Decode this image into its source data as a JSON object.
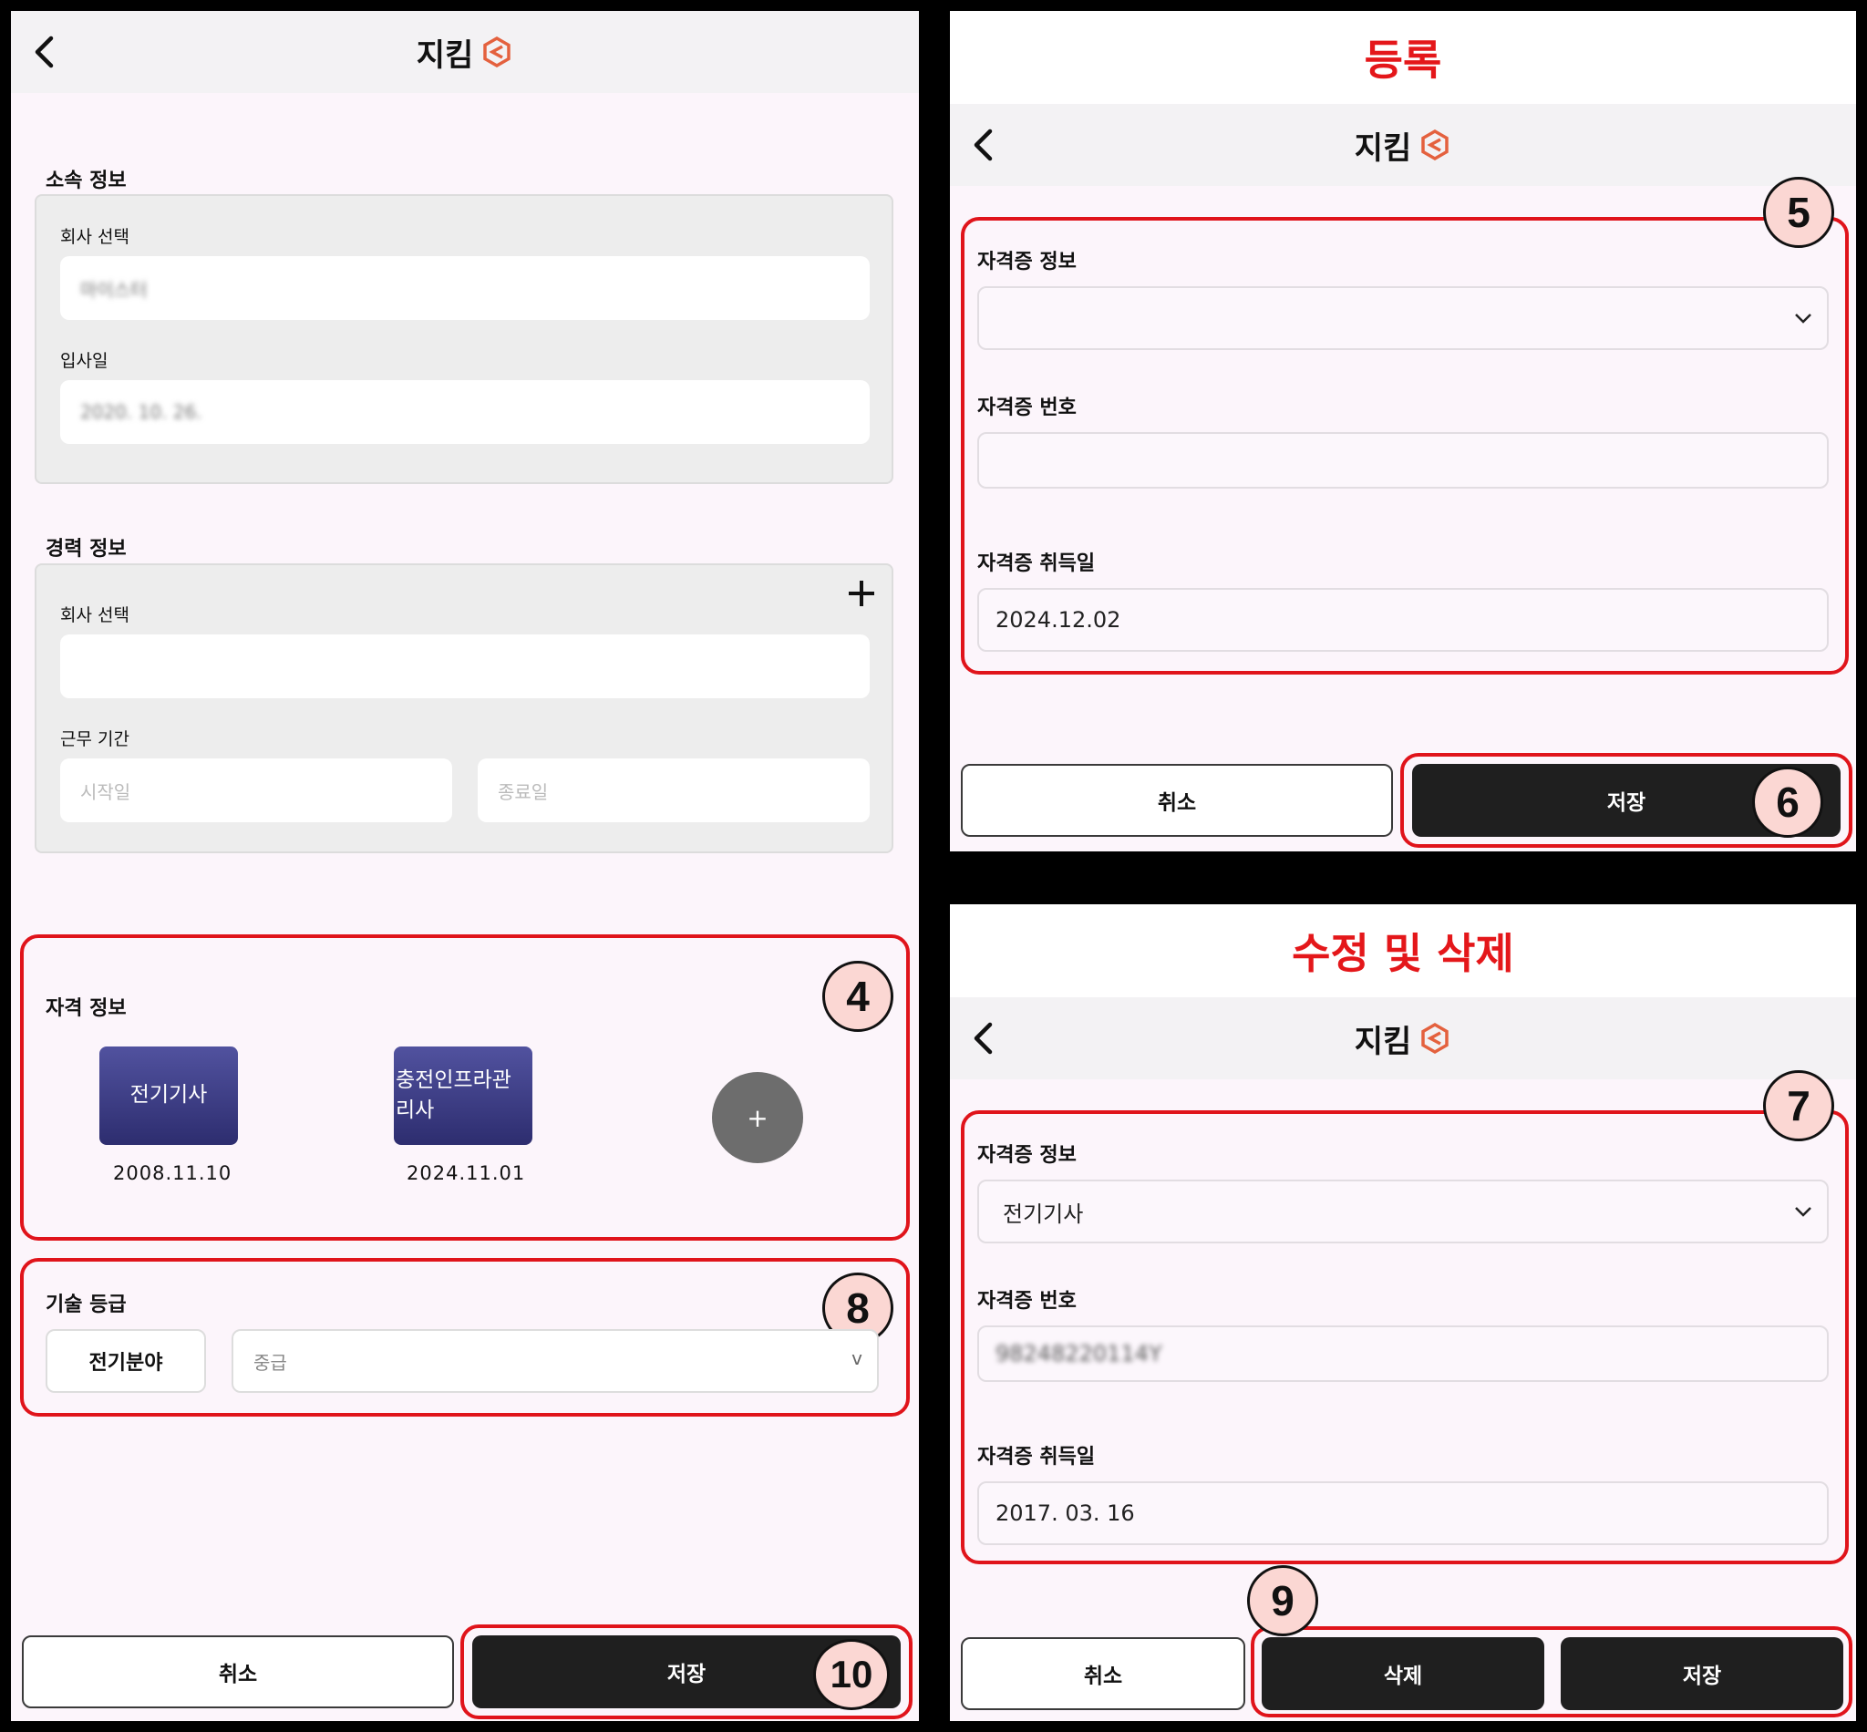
{
  "app": {
    "title": "지킴"
  },
  "left": {
    "affiliation": {
      "title": "소속 정보",
      "company_label": "회사 선택",
      "company_value": "마이스터",
      "hire_label": "입사일",
      "hire_value": "2020. 10. 26."
    },
    "career": {
      "title": "경력 정보",
      "company_label": "회사 선택",
      "period_label": "근무 기간",
      "start_placeholder": "시작일",
      "end_placeholder": "종료일"
    },
    "qualification": {
      "title": "자격 정보",
      "certs": [
        {
          "name": "전기기사",
          "date": "2008.11.10"
        },
        {
          "name": "충전인프라관리사",
          "date": "2024.11.01"
        }
      ],
      "add_label": "+"
    },
    "skill": {
      "title": "기술 등급",
      "field_label": "전기분야",
      "grade_value": "중급",
      "grade_arrow": "v"
    },
    "buttons": {
      "cancel": "취소",
      "save": "저장"
    }
  },
  "register": {
    "banner": "등록",
    "cert_info_label": "자격증 정보",
    "cert_number_label": "자격증 번호",
    "cert_date_label": "자격증 취득일",
    "cert_date_value": "2024.12.02",
    "buttons": {
      "cancel": "취소",
      "save": "저장"
    }
  },
  "edit": {
    "banner": "수정 및 삭제",
    "cert_info_label": "자격증 정보",
    "cert_info_value": "전기기사",
    "cert_number_label": "자격증 번호",
    "cert_number_value": "98248220114Y",
    "cert_date_label": "자격증 취득일",
    "cert_date_value": "2017. 03. 16",
    "buttons": {
      "cancel": "취소",
      "delete": "삭제",
      "save": "저장"
    }
  },
  "callouts": [
    "4",
    "5",
    "6",
    "7",
    "8",
    "9",
    "10"
  ],
  "colors": {
    "accent_red": "#e0141b",
    "dark_button": "#1f1f1f",
    "cert_tile": "#3d3e85",
    "logo": "#e4613e"
  }
}
